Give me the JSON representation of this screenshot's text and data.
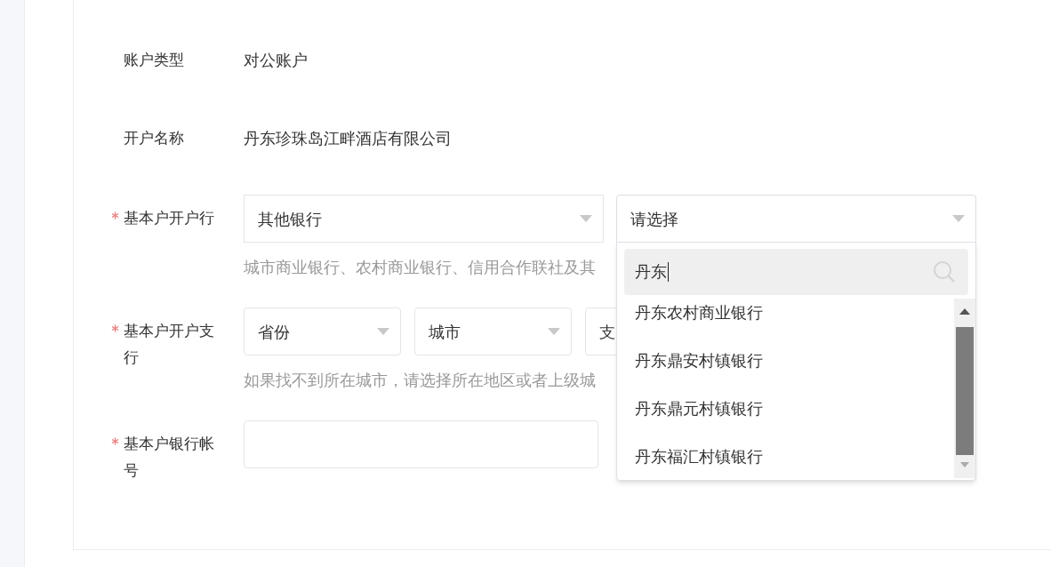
{
  "account_type": {
    "label": "账户类型",
    "value": "对公账户"
  },
  "account_name": {
    "label": "开户名称",
    "value": "丹东珍珠岛江畔酒店有限公司"
  },
  "bank": {
    "label": "基本户开户行",
    "required": true,
    "bank_type": {
      "value": "其他银行"
    },
    "bank_select": {
      "value": "请选择",
      "expanded": true
    },
    "hint": "城市商业银行、农村商业银行、信用合作联社及其",
    "dropdown": {
      "search": {
        "value": "丹东"
      },
      "options": [
        {
          "label": "丹东农村商业银行"
        },
        {
          "label": "丹东鼎安村镇银行"
        },
        {
          "label": "丹东鼎元村镇银行"
        },
        {
          "label": "丹东福汇村镇银行"
        }
      ]
    }
  },
  "branch": {
    "label": "基本户开户支行",
    "required": true,
    "selects": [
      {
        "value": "省份"
      },
      {
        "value": "城市"
      },
      {
        "value": "支"
      }
    ],
    "hint": "如果找不到所在城市，请选择所在地区或者上级城"
  },
  "account_number": {
    "label": "基本户银行帐号",
    "required": true
  }
}
